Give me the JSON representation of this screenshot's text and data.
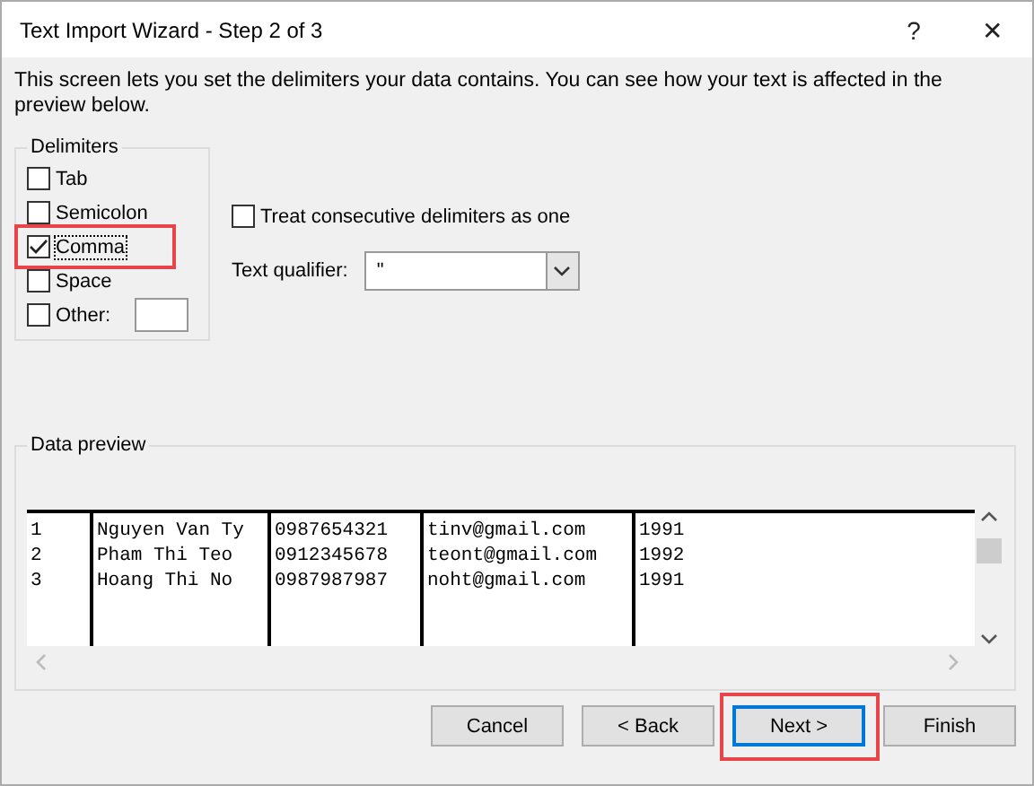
{
  "window": {
    "title": "Text Import Wizard - Step 2 of 3",
    "help": "?",
    "close": "✕"
  },
  "description": "This screen lets you set the delimiters your data contains.  You can see how your text is affected in the preview below.",
  "delimiters": {
    "title": "Delimiters",
    "items": [
      {
        "label": "Tab",
        "checked": false,
        "highlighted": false
      },
      {
        "label": "Semicolon",
        "checked": false,
        "highlighted": false
      },
      {
        "label": "Comma",
        "checked": true,
        "highlighted": true
      },
      {
        "label": "Space",
        "checked": false,
        "highlighted": false
      },
      {
        "label": "Other:",
        "checked": false,
        "highlighted": false,
        "kind": "field"
      }
    ]
  },
  "consecutive": {
    "label": "Treat consecutive delimiters as one",
    "checked": false
  },
  "qualifier": {
    "label": "Text qualifier:",
    "value": "\""
  },
  "preview": {
    "title": "Data preview",
    "rows": [
      [
        "1",
        "Nguyen Van Ty",
        "0987654321",
        "tinv@gmail.com",
        "1991"
      ],
      [
        "2",
        "Pham Thi Teo",
        "0912345678",
        "teont@gmail.com",
        "1992"
      ],
      [
        "3",
        "Hoang Thi No",
        "0987987987",
        "noht@gmail.com",
        "1991"
      ]
    ]
  },
  "buttons": [
    {
      "label": "Cancel",
      "default": false,
      "highlighted": false
    },
    {
      "label": "< Back",
      "default": false,
      "highlighted": false
    },
    {
      "label": "Next >",
      "default": true,
      "highlighted": true
    },
    {
      "label": "Finish",
      "default": false,
      "highlighted": false
    }
  ]
}
